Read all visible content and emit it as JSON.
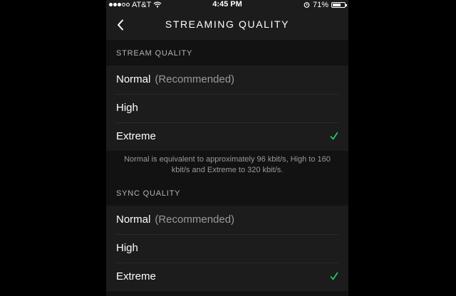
{
  "status_bar": {
    "carrier": "AT&T",
    "time": "4:45 PM",
    "battery": "71%",
    "battery_level": 0.71,
    "signal_bars_filled": 3,
    "signal_bars_total": 5
  },
  "nav": {
    "title": "STREAMING QUALITY",
    "back_icon": "chevron-left-icon"
  },
  "stream_quality": {
    "header": "STREAM QUALITY",
    "options": [
      {
        "label": "Normal",
        "note": "(Recommended)",
        "selected": false
      },
      {
        "label": "High",
        "note": "",
        "selected": false
      },
      {
        "label": "Extreme",
        "note": "",
        "selected": true
      }
    ],
    "info": "Normal is equivalent to approximately 96 kbit/s, High to 160 kbit/s and Extreme to 320 kbit/s."
  },
  "sync_quality": {
    "header": "SYNC QUALITY",
    "options": [
      {
        "label": "Normal",
        "note": "(Recommended)",
        "selected": false
      },
      {
        "label": "High",
        "note": "",
        "selected": false
      },
      {
        "label": "Extreme",
        "note": "",
        "selected": true
      }
    ]
  },
  "colors": {
    "accent": "#1ed760",
    "background": "#121212",
    "row_background": "#1c1c1c"
  }
}
